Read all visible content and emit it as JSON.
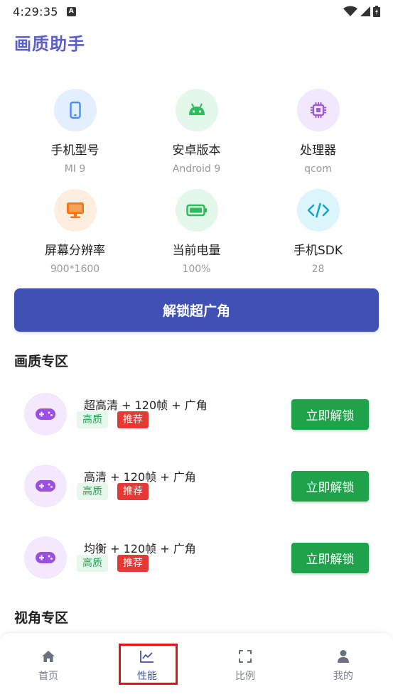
{
  "status_bar": {
    "time": "4:29:35",
    "notif_icon": "A"
  },
  "app": {
    "title": "画质助手"
  },
  "info_items": [
    {
      "label": "手机型号",
      "value": "MI 9",
      "icon": "phone-icon",
      "color": "#4a8af4",
      "bg": "#e3eefe"
    },
    {
      "label": "安卓版本",
      "value": "Android 9",
      "icon": "android-icon",
      "color": "#2ebd5c",
      "bg": "#e3f8ea"
    },
    {
      "label": "处理器",
      "value": "qcom",
      "icon": "chip-icon",
      "color": "#9b59d6",
      "bg": "#f2e8fd"
    },
    {
      "label": "屏幕分辨率",
      "value": "900*1600",
      "icon": "monitor-icon",
      "color": "#f27a1a",
      "bg": "#fdeee0"
    },
    {
      "label": "当前电量",
      "value": "100%",
      "icon": "battery-icon",
      "color": "#2ebd5c",
      "bg": "#e3f8ea"
    },
    {
      "label": "手机SDK",
      "value": "28",
      "icon": "code-icon",
      "color": "#14a5c9",
      "bg": "#dcf6fb"
    }
  ],
  "unlock_wide_label": "解锁超广角",
  "quality_section_title": "画质专区",
  "games": [
    {
      "name": "超高清 + 120帧 + 广角",
      "tag_hq": "高质",
      "tag_rec": "推荐",
      "button": "立即解锁"
    },
    {
      "name": "高清 + 120帧 + 广角",
      "tag_hq": "高质",
      "tag_rec": "推荐",
      "button": "立即解锁"
    },
    {
      "name": "均衡 + 120帧 + 广角",
      "tag_hq": "高质",
      "tag_rec": "推荐",
      "button": "立即解锁"
    }
  ],
  "view_section_title": "视角专区",
  "nav": [
    {
      "label": "首页",
      "icon": "home-icon"
    },
    {
      "label": "性能",
      "icon": "chart-icon",
      "active": true
    },
    {
      "label": "比例",
      "icon": "expand-icon"
    },
    {
      "label": "我的",
      "icon": "user-icon"
    }
  ],
  "colors": {
    "brand": "#5b5fc7",
    "primary_button": "#3f51b5",
    "unlock_button": "#1fa34a",
    "tag_recommend": "#e53935",
    "highlight": "#e0131b"
  }
}
